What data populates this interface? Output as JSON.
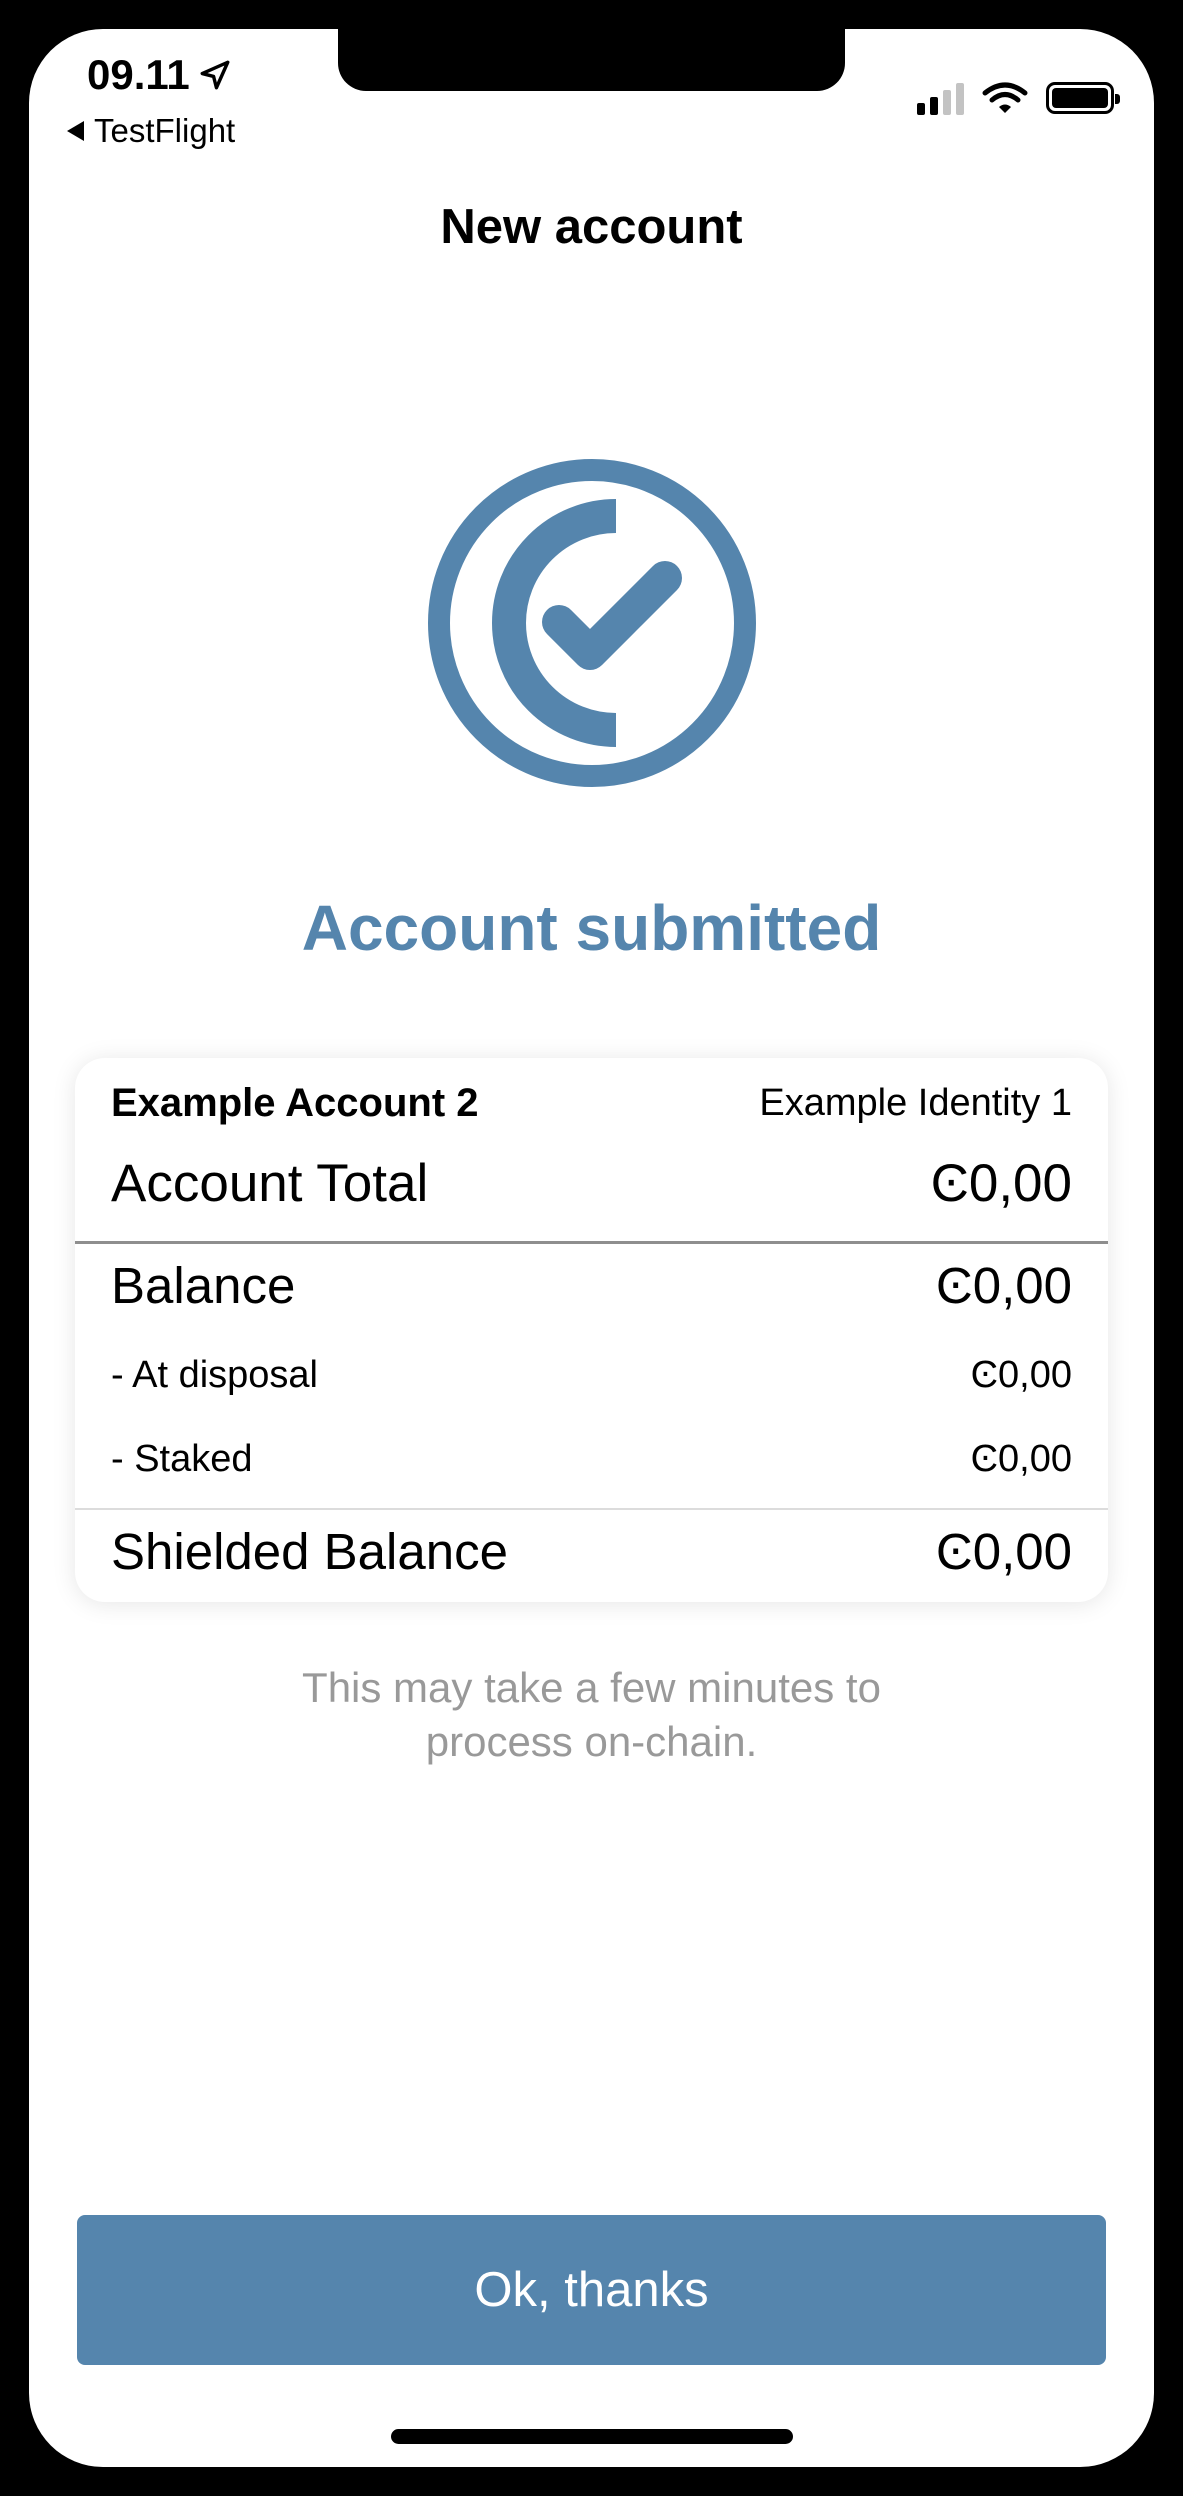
{
  "status_bar": {
    "time": "09.11",
    "back_app": "TestFlight"
  },
  "nav": {
    "title": "New account"
  },
  "success": {
    "title": "Account submitted"
  },
  "account_card": {
    "account_name": "Example Account 2",
    "identity_name": "Example Identity 1",
    "rows": {
      "total": {
        "label": "Account Total",
        "value": "Ͼ0,00"
      },
      "balance": {
        "label": "Balance",
        "value": "Ͼ0,00"
      },
      "at_disposal": {
        "label": "- At disposal",
        "value": "Ͼ0,00"
      },
      "staked": {
        "label": "- Staked",
        "value": "Ͼ0,00"
      },
      "shielded": {
        "label": "Shielded Balance",
        "value": "Ͼ0,00"
      }
    }
  },
  "note": "This may take a few minutes to process on-chain.",
  "actions": {
    "ok_label": "Ok, thanks"
  },
  "colors": {
    "accent": "#5585ad",
    "muted_text": "#999999"
  },
  "icons": [
    "location-arrow-icon",
    "back-triangle-icon",
    "signal-icon",
    "wifi-icon",
    "battery-icon",
    "concordium-check-icon"
  ]
}
